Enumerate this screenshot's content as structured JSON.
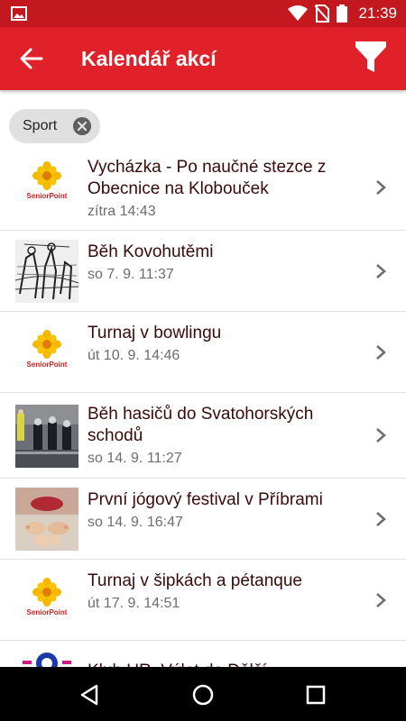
{
  "status_bar": {
    "time": "21:39",
    "icons": [
      "image-icon",
      "wifi-icon",
      "no-sim-icon",
      "battery-icon"
    ],
    "color": "#c4181f"
  },
  "app_bar": {
    "title": "Kalendář akcí",
    "color": "#e02129",
    "back_icon": "arrow-left-icon",
    "filter_icon": "filter-icon"
  },
  "filter_chip": {
    "label": "Sport",
    "close_icon": "close-circle-icon"
  },
  "events": [
    {
      "title": "Vycházka - Po naučné stezce z Obecnice na Klobouček",
      "date": "zítra 14:43",
      "thumb": "seniorpoint-logo",
      "logo_text": "SeniorPoint"
    },
    {
      "title": "Běh Kovohutěmi",
      "date": "so 7. 9. 11:37",
      "thumb": "sketch-image"
    },
    {
      "title": "Turnaj v bowlingu",
      "date": "út 10. 9. 14:46",
      "thumb": "seniorpoint-logo",
      "logo_text": "SeniorPoint"
    },
    {
      "title": "Běh hasičů do Svatohorských schodů",
      "date": "so 14. 9. 11:27",
      "thumb": "firefighters-photo"
    },
    {
      "title": "První jógový festival v Příbrami",
      "date": "so 14. 9. 16:47",
      "thumb": "yoga-photo"
    },
    {
      "title": "Turnaj v šipkách a pétanque",
      "date": "út 17. 9. 14:51",
      "thumb": "seniorpoint-logo",
      "logo_text": "SeniorPoint"
    },
    {
      "title": "Klub UR. Výlet do Dělčí...",
      "date": "",
      "thumb": "club-logo"
    }
  ],
  "nav_bar": {
    "buttons": [
      "back-triangle-icon",
      "home-circle-icon",
      "recents-square-icon"
    ]
  }
}
